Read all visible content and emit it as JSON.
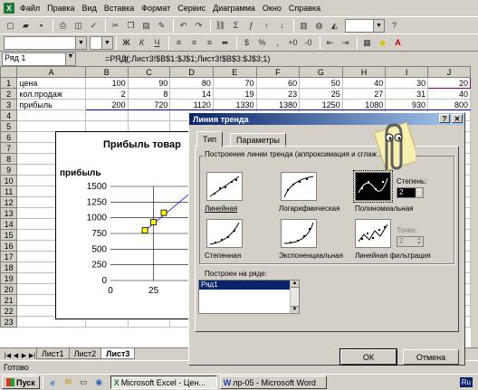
{
  "menu": [
    "Файл",
    "Правка",
    "Вид",
    "Вставка",
    "Формат",
    "Сервис",
    "Диаграмма",
    "Окно",
    "Справка"
  ],
  "namebox": "Ряд 1",
  "formula": "=РЯД(;Лист3!$B$1:$J$1;Лист3!$B$3:$J$3;1)",
  "columns": [
    "A",
    "B",
    "C",
    "D",
    "E",
    "F",
    "G",
    "H",
    "I",
    "J"
  ],
  "rows": [
    {
      "n": "1",
      "label": "цена",
      "values": [
        "100",
        "90",
        "80",
        "70",
        "60",
        "50",
        "40",
        "30",
        "20"
      ]
    },
    {
      "n": "2",
      "label": "кол.продаж",
      "values": [
        "2",
        "8",
        "14",
        "19",
        "23",
        "25",
        "27",
        "31",
        "40"
      ]
    },
    {
      "n": "3",
      "label": "прибыль",
      "values": [
        "200",
        "720",
        "1120",
        "1330",
        "1380",
        "1250",
        "1080",
        "930",
        "800"
      ]
    },
    {
      "n": "4",
      "label": "",
      "values": []
    },
    {
      "n": "5",
      "label": "",
      "values": []
    },
    {
      "n": "6",
      "label": "",
      "values": []
    },
    {
      "n": "7",
      "label": "",
      "values": []
    },
    {
      "n": "8",
      "label": "",
      "values": []
    },
    {
      "n": "9",
      "label": "",
      "values": []
    },
    {
      "n": "10",
      "label": "",
      "values": []
    },
    {
      "n": "11",
      "label": "",
      "values": []
    },
    {
      "n": "12",
      "label": "",
      "values": []
    },
    {
      "n": "13",
      "label": "",
      "values": []
    },
    {
      "n": "14",
      "label": "",
      "values": []
    },
    {
      "n": "15",
      "label": "",
      "values": []
    },
    {
      "n": "16",
      "label": "",
      "values": []
    },
    {
      "n": "17",
      "label": "",
      "values": []
    },
    {
      "n": "18",
      "label": "",
      "values": []
    },
    {
      "n": "19",
      "label": "",
      "values": []
    },
    {
      "n": "20",
      "label": "",
      "values": []
    },
    {
      "n": "21",
      "label": "",
      "values": []
    },
    {
      "n": "22",
      "label": "",
      "values": []
    },
    {
      "n": "23",
      "label": "",
      "values": []
    }
  ],
  "chart": {
    "title": "Прибыль товар",
    "ylabel": "прибыль",
    "yticks": [
      "1500",
      "1250",
      "1000",
      "750",
      "500",
      "250",
      "0"
    ],
    "xticks": [
      "0",
      "25"
    ],
    "points": [
      [
        20,
        800
      ],
      [
        25,
        930
      ],
      [
        31,
        1080
      ]
    ]
  },
  "sheet_tabs": [
    "Лист1",
    "Лист2",
    "Лист3"
  ],
  "status": "Готово",
  "taskbar": {
    "start": "Пуск",
    "tasks": [
      "Microsoft Excel - Цен...",
      "лр-05 - Microsoft Word"
    ],
    "lang": "Ru"
  },
  "dialog": {
    "title": "Линия тренда",
    "tabs": [
      "Тип",
      "Параметры"
    ],
    "group_label": "Построение линии тренда (аппроксимация и сглаж",
    "types": [
      "Линейная",
      "Логарифмическая",
      "Полиномиальная",
      "Степенная",
      "Экспоненциальная",
      "Линейная фильтрация"
    ],
    "degree_label": "Степень:",
    "degree_value": "2",
    "points_label": "Точки:",
    "points_value": "2",
    "series_label": "Построен на ряде:",
    "series_item": "Ряд1",
    "ok": "ОК",
    "cancel": "Отмена"
  }
}
